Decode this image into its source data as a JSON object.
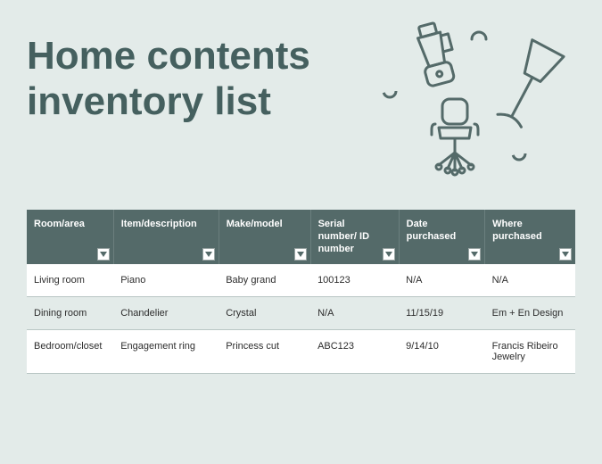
{
  "title": "Home contents inventory list",
  "columns": [
    {
      "key": "room",
      "label": "Room/area"
    },
    {
      "key": "item",
      "label": "Item/description"
    },
    {
      "key": "make",
      "label": "Make/model"
    },
    {
      "key": "serial",
      "label": "Serial number/ ID number"
    },
    {
      "key": "date",
      "label": "Date purchased"
    },
    {
      "key": "where",
      "label": "Where purchased"
    }
  ],
  "rows": [
    {
      "room": "Living room",
      "item": "Piano",
      "make": "Baby grand",
      "serial": "100123",
      "date": "N/A",
      "where": "N/A"
    },
    {
      "room": "Dining room",
      "item": "Chandelier",
      "make": "Crystal",
      "serial": "N/A",
      "date": "11/15/19",
      "where": "Em + En Design"
    },
    {
      "room": "Bedroom/closet",
      "item": "Engagement ring",
      "make": "Princess cut",
      "serial": "ABC123",
      "date": "9/14/10",
      "where": "Francis Ribeiro Jewelry"
    }
  ],
  "colors": {
    "header_bg": "#546a69",
    "page_bg": "#e3ebe9",
    "title_color": "#45605f"
  }
}
